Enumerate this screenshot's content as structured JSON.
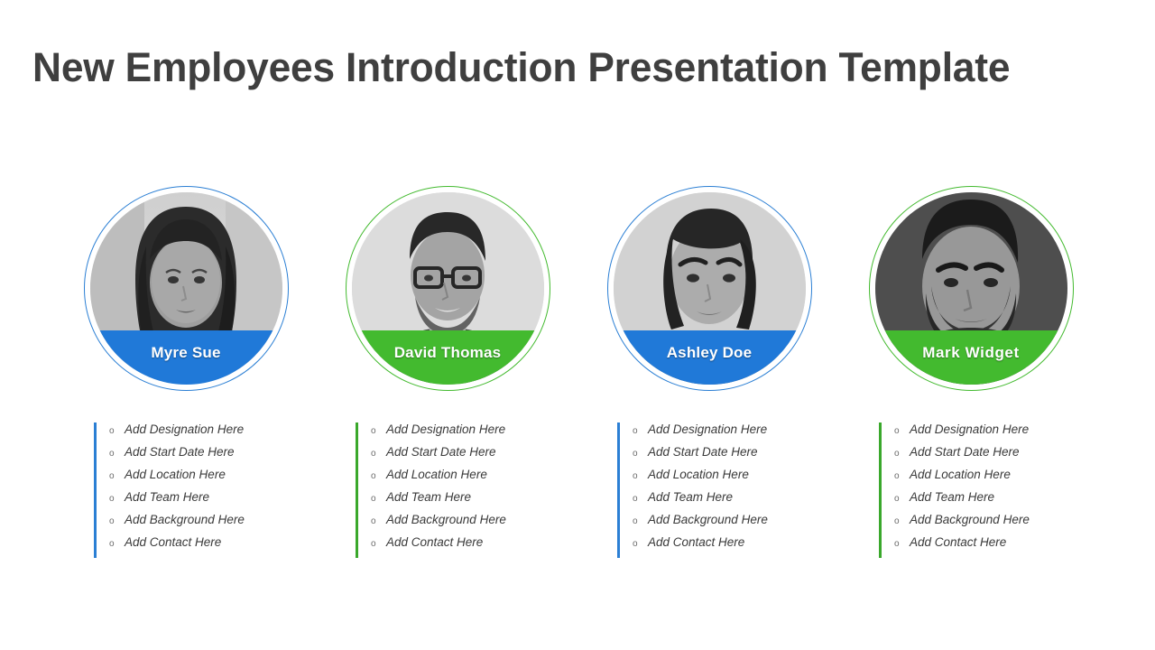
{
  "slide": {
    "title": "New Employees Introduction Presentation Template",
    "background_color": "#ffffff",
    "title_color": "#3f3f3f"
  },
  "colors": {
    "blue": "#2079d8",
    "blue_ring": "#2b7fd4",
    "green": "#43ba2f",
    "green_ring": "#3aa82b",
    "name_text": "#ffffff",
    "detail_text": "#3a3a3a"
  },
  "bullet_glyph": "o",
  "cards": [
    {
      "name": "Myre Sue",
      "accent": "blue",
      "photo": "portrait-woman-long-hair",
      "details": [
        "Add  Designation Here",
        "Add Start Date Here",
        "Add Location Here",
        "Add Team Here",
        "Add Background Here",
        "Add Contact Here"
      ]
    },
    {
      "name": "David Thomas",
      "accent": "green",
      "photo": "portrait-man-glasses-suit",
      "details": [
        "Add  Designation Here",
        "Add Start Date Here",
        "Add Location Here",
        "Add Team Here",
        "Add Background Here",
        "Add Contact Here"
      ]
    },
    {
      "name": "Ashley Doe",
      "accent": "blue",
      "photo": "portrait-woman-short-hair",
      "details": [
        "Add  Designation Here",
        "Add Start Date Here",
        "Add Location Here",
        "Add Team Here",
        "Add Background Here",
        "Add Contact Here"
      ]
    },
    {
      "name": "Mark  Widget",
      "accent": "green",
      "photo": "portrait-man-beard",
      "details": [
        "Add  Designation Here",
        "Add Start Date Here",
        "Add Location Here",
        "Add Team Here",
        "Add Background Here",
        "Add Contact Here"
      ]
    }
  ]
}
